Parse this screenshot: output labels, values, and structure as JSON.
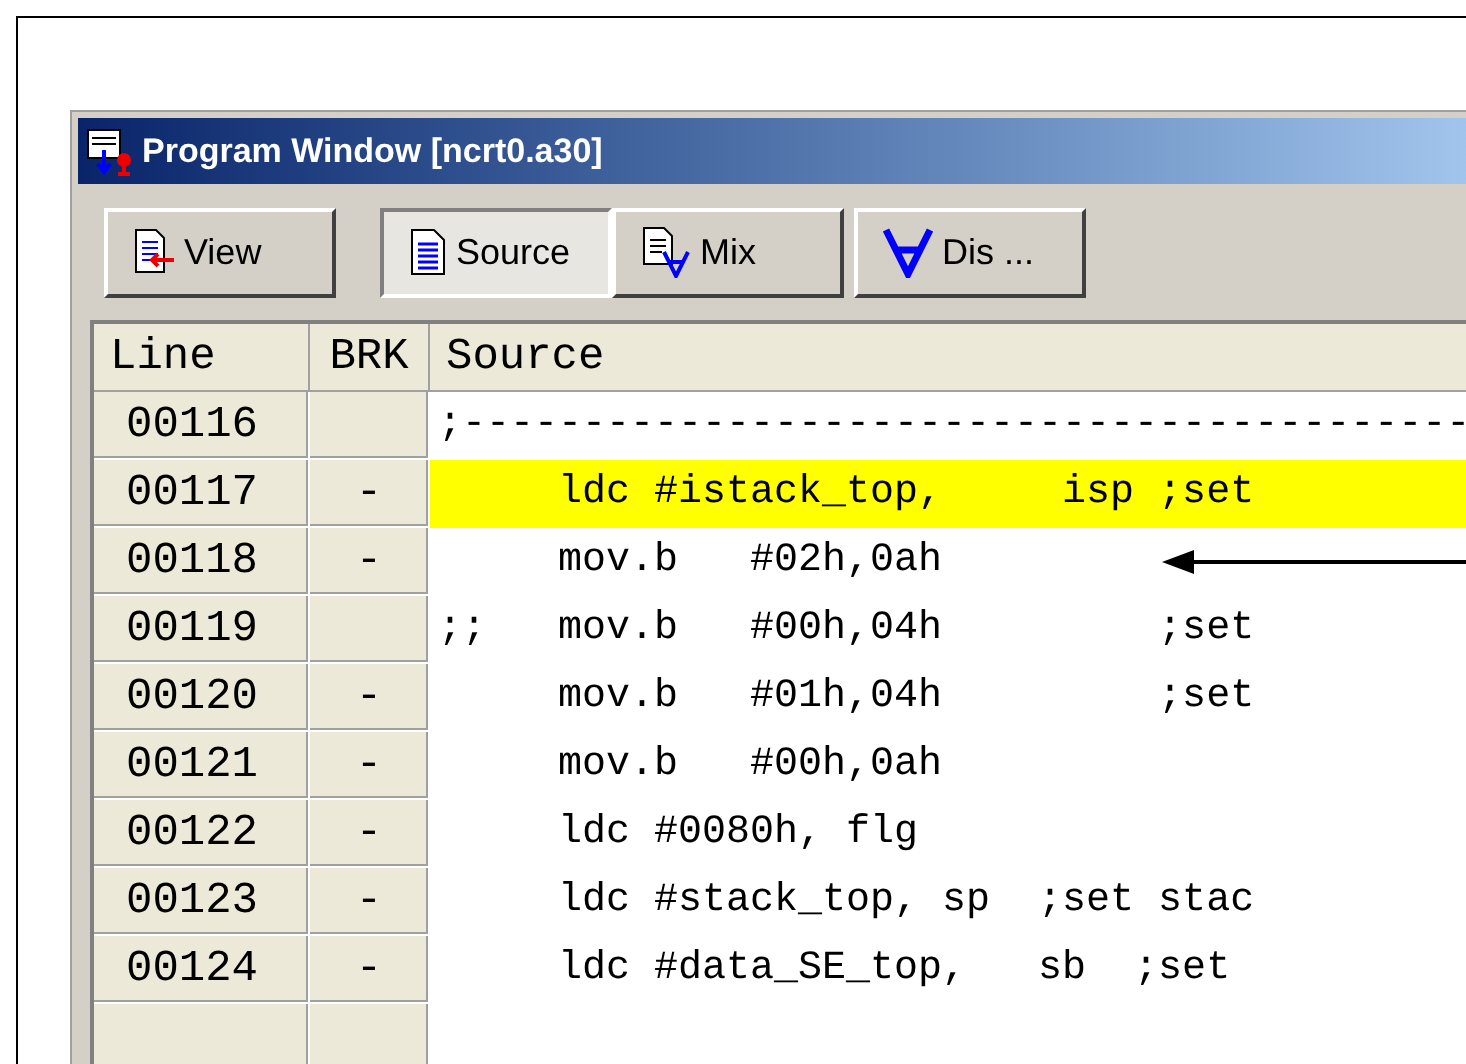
{
  "window": {
    "title": "Program Window [ncrt0.a30]"
  },
  "toolbar": [
    {
      "label": "View",
      "kind": "view",
      "selected": false
    },
    {
      "label": "Source",
      "kind": "source",
      "selected": true
    },
    {
      "label": "Mix",
      "kind": "mix",
      "selected": false
    },
    {
      "label": "Dis ...",
      "kind": "dis",
      "selected": false
    }
  ],
  "table": {
    "columns": [
      "Line",
      "BRK",
      "Source"
    ],
    "rows": [
      {
        "line": "00116",
        "source": ";------------------------------------------",
        "highlighted": false
      },
      {
        "line": "00117",
        "brk": "-",
        "source": "     ldc #istack_top,     isp ;set",
        "highlighted": true
      },
      {
        "line": "00118",
        "brk": "-",
        "source": "     mov.b   #02h,0ah",
        "highlighted": false,
        "arrow": true
      },
      {
        "line": "00119",
        "source": ";;   mov.b   #00h,04h         ;set",
        "highlighted": false
      },
      {
        "line": "00120",
        "brk": "-",
        "source": "     mov.b   #01h,04h         ;set",
        "highlighted": false
      },
      {
        "line": "00121",
        "brk": "-",
        "source": "     mov.b   #00h,0ah",
        "highlighted": false
      },
      {
        "line": "00122",
        "brk": "-",
        "source": "     ldc #0080h, flg",
        "highlighted": false
      },
      {
        "line": "00123",
        "brk": "-",
        "source": "     ldc #stack_top, sp  ;set stac",
        "highlighted": false
      },
      {
        "line": "00124",
        "brk": "-",
        "source": "     ldc #data_SE_top,   sb  ;set",
        "highlighted": false
      }
    ]
  }
}
